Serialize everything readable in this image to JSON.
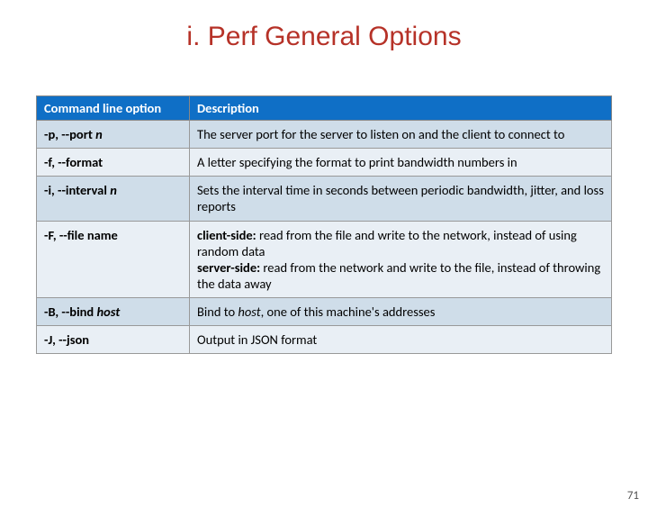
{
  "title": "i. Perf General Options",
  "headers": {
    "col1": "Command line option",
    "col2": "Description"
  },
  "rows": [
    {
      "opt_pre": "-p, --port ",
      "opt_em": "n",
      "desc_parts": [
        {
          "t": "The server port for the server to listen on and the client to connect to"
        }
      ]
    },
    {
      "opt_pre": "-f, --format",
      "opt_em": "",
      "desc_parts": [
        {
          "t": "A letter specifying the format to print bandwidth numbers in"
        }
      ]
    },
    {
      "opt_pre": "-i, --interval ",
      "opt_em": "n",
      "desc_parts": [
        {
          "t": "Sets the interval time in seconds between periodic bandwidth, jitter, and loss reports"
        }
      ]
    },
    {
      "opt_pre": "-F, --file name",
      "opt_em": "",
      "desc_parts": [
        {
          "b": "client-side:"
        },
        {
          "t": " read from the file and write to the network, instead of using random data"
        },
        {
          "br": true
        },
        {
          "b": "server-side:"
        },
        {
          "t": " read from the network and write to the file, instead of throwing the data away"
        }
      ]
    },
    {
      "opt_pre": "-B, --bind ",
      "opt_em": "host",
      "desc_parts": [
        {
          "t": "Bind to "
        },
        {
          "i": "host"
        },
        {
          "t": ", one of this machine's addresses"
        }
      ]
    },
    {
      "opt_pre": "-J, --json",
      "opt_em": "",
      "desc_parts": [
        {
          "t": "Output in JSON format"
        }
      ]
    }
  ],
  "page_number": "71"
}
